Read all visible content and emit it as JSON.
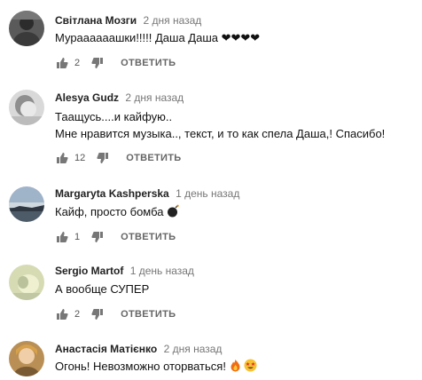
{
  "comments": [
    {
      "author": "Світлана Мозги",
      "time": "2 дня назад",
      "lines": [
        "Мураааааашки!!!!! Даша Даша ❤❤❤❤"
      ],
      "likes": "2",
      "reply_label": "ОТВЕТИТЬ"
    },
    {
      "author": "Alesya Gudz",
      "time": "2 дня назад",
      "lines": [
        "Таащусь....и кайфую..",
        "Мне нравится музыка.., текст, и то как спела Даша,! Спасибо!"
      ],
      "likes": "12",
      "reply_label": "ОТВЕТИТЬ"
    },
    {
      "author": "Margaryta Kashperska",
      "time": "1 день назад",
      "lines": [
        "Кайф, просто бомба"
      ],
      "likes": "1",
      "reply_label": "ОТВЕТИТЬ"
    },
    {
      "author": "Sergio Martof",
      "time": "1 день назад",
      "lines": [
        "А вообще СУПЕР"
      ],
      "likes": "2",
      "reply_label": "ОТВЕТИТЬ"
    },
    {
      "author": "Анастасія Матієнко",
      "time": "2 дня назад",
      "lines": [
        "Огонь! Невозможно оторваться!"
      ]
    }
  ]
}
